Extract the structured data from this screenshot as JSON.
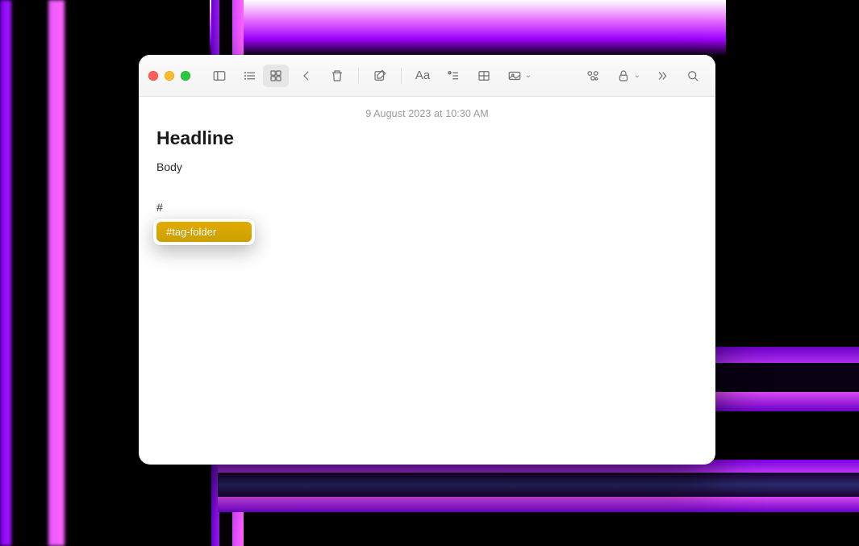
{
  "note": {
    "timestamp": "9 August 2023 at 10:30 AM",
    "title": "Headline",
    "body": "Body",
    "hash_literal": "#"
  },
  "suggestion": {
    "tag_label": "#tag-folder"
  },
  "colors": {
    "tag_bg": "#d9a400",
    "traffic_red": "#ff5f57",
    "traffic_yellow": "#febc2e",
    "traffic_green": "#28c840"
  },
  "toolbar": {
    "format_text_glyph": "Aa"
  }
}
